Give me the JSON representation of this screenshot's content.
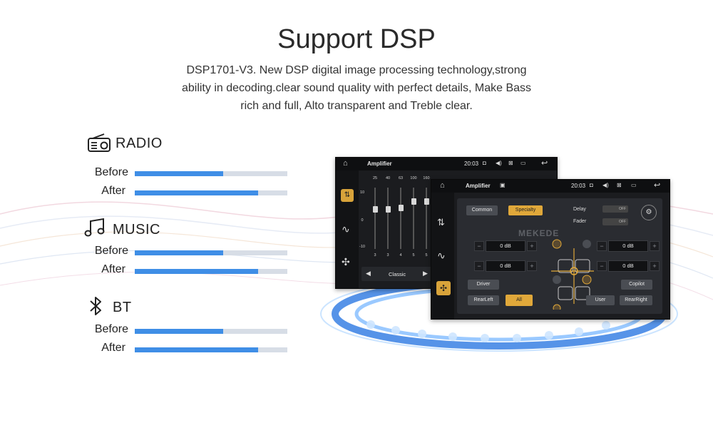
{
  "header": {
    "title": "Support DSP",
    "description_lines": [
      "DSP1701-V3. New DSP digital image processing technology,strong",
      "ability in decoding.clear sound quality with perfect details, Make Bass",
      "rich and full, Alto transparent and Treble clear."
    ]
  },
  "comparisons": [
    {
      "label": "RADIO",
      "icon": "radio-icon",
      "before_label": "Before",
      "after_label": "After",
      "before_level": 0.58,
      "after_level": 0.81
    },
    {
      "label": "MUSIC",
      "icon": "music-note-icon",
      "before_label": "Before",
      "after_label": "After",
      "before_level": 0.58,
      "after_level": 0.81
    },
    {
      "label": "BT",
      "icon": "bluetooth-icon",
      "before_label": "Before",
      "after_label": "After",
      "before_level": 0.58,
      "after_level": 0.81
    }
  ],
  "colors": {
    "bar_fill": "#3f8ee6",
    "bar_track": "#d7dde6",
    "accent": "#e0a83a"
  },
  "screen_back": {
    "title": "Amplifier",
    "time": "20:03",
    "eq_freqs": [
      "25",
      "40",
      "63",
      "100",
      "160"
    ],
    "eq_scale": [
      "10",
      "0",
      "-10"
    ],
    "eq_values": [
      "3",
      "3",
      "4",
      "5",
      "5"
    ],
    "preset": "Classic"
  },
  "screen_front": {
    "title": "Amplifier",
    "time": "20:03",
    "mode_tabs": [
      "Common",
      "Specialty"
    ],
    "active_mode": "Specialty",
    "delay_label": "Delay",
    "fader_label": "Fader",
    "toggle_off": "OFF",
    "db_values": [
      "0 dB",
      "0 dB",
      "0 dB",
      "0 dB"
    ],
    "buttons": {
      "driver": "Driver",
      "copilot": "Copilot",
      "rear_left": "RearLeft",
      "all": "All",
      "user": "User",
      "rear_right": "RearRight"
    },
    "watermark": "MEKEDE"
  }
}
